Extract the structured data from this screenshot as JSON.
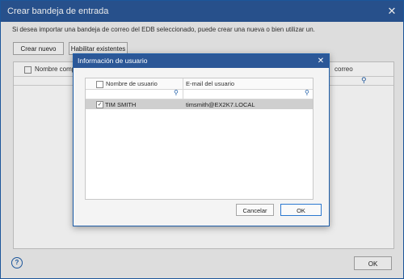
{
  "outer": {
    "title": "Crear bandeja de entrada",
    "close_glyph": "✕",
    "description": "Si desea importar una bandeja de correo del EDB seleccionado, puede crear una nueva o bien utilizar un.",
    "buttons": {
      "create": "Crear nuevo",
      "enable": "Habilitar existentes",
      "ok": "OK"
    },
    "table": {
      "col_name": "Nombre comple",
      "col_right": "correo"
    },
    "help_glyph": "?"
  },
  "modal": {
    "title": "Información de usuario",
    "close_glyph": "✕",
    "columns": {
      "user": "Nombre de usuario",
      "email": "E-mail del usuario"
    },
    "rows": [
      {
        "checked": true,
        "check_glyph": "✓",
        "user": "TIM SMITH",
        "email": "timsmith@EX2K7.LOCAL"
      }
    ],
    "buttons": {
      "cancel": "Cancelar",
      "ok": "OK"
    }
  },
  "icons": {
    "search": "⚲"
  },
  "colors": {
    "titlebar": "#2b5797",
    "accent": "#1f5ea8",
    "selected_row": "#cfcfcf"
  }
}
